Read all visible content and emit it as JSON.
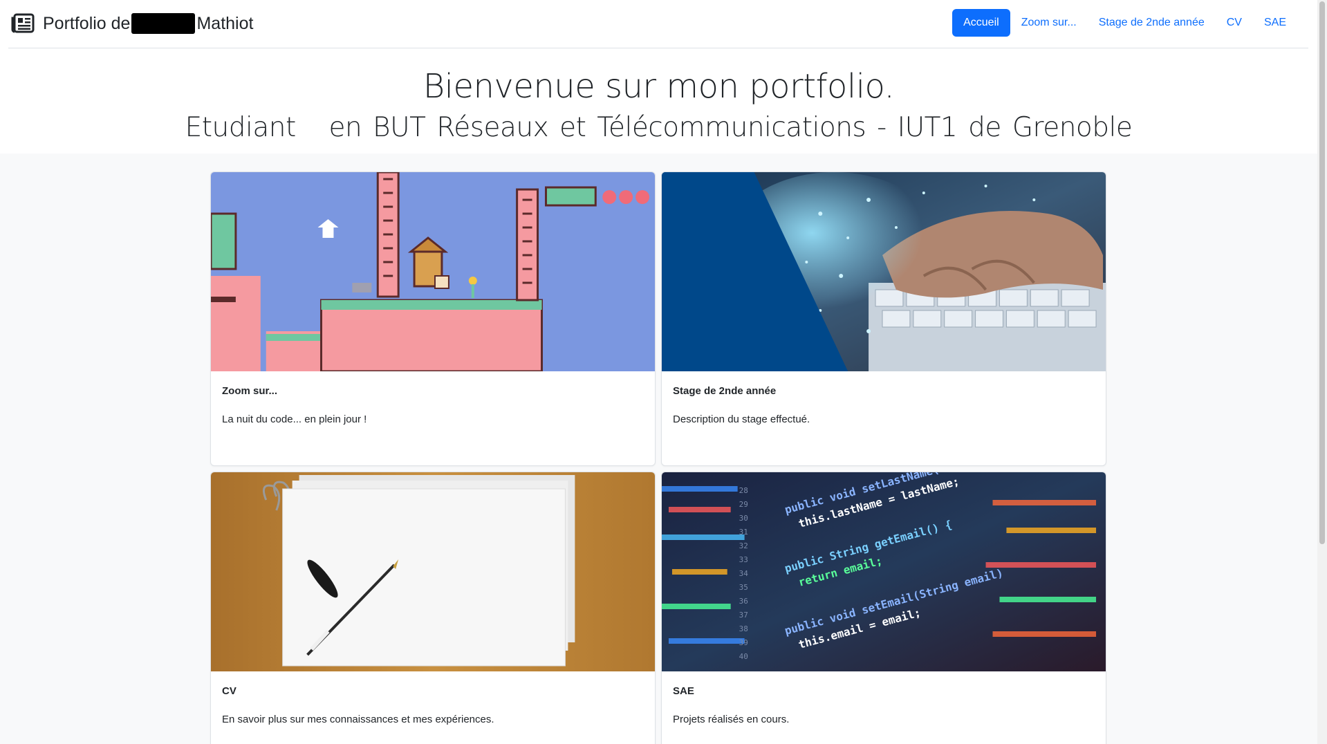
{
  "brand": {
    "prefix": "Portfolio de",
    "suffix": "Mathiot",
    "icon": "newspaper-icon"
  },
  "nav": {
    "items": [
      {
        "label": "Accueil",
        "active": true
      },
      {
        "label": "Zoom sur...",
        "active": false
      },
      {
        "label": "Stage de 2nde année",
        "active": false
      },
      {
        "label": "CV",
        "active": false
      },
      {
        "label": "SAE",
        "active": false
      }
    ]
  },
  "hero": {
    "title": "Bienvenue sur mon portfolio.",
    "subtitle": "Etudiant   en BUT Réseaux et Télécommunications - IUT1 de Grenoble"
  },
  "cards": [
    {
      "title": "Zoom sur...",
      "text": "La nuit du code... en plein jour !",
      "image": "pixel-game-image"
    },
    {
      "title": "Stage de 2nde année",
      "text": "Description du stage effectué.",
      "image": "keyboard-network-image"
    },
    {
      "title": "CV",
      "text": "En savoir plus sur mes connaissances et mes expériences.",
      "image": "paper-pen-image"
    },
    {
      "title": "SAE",
      "text": "Projets réalisés en cours.",
      "image": "code-screen-image"
    }
  ],
  "colors": {
    "accent": "#0d6efd",
    "background": "#f8f9fa"
  }
}
